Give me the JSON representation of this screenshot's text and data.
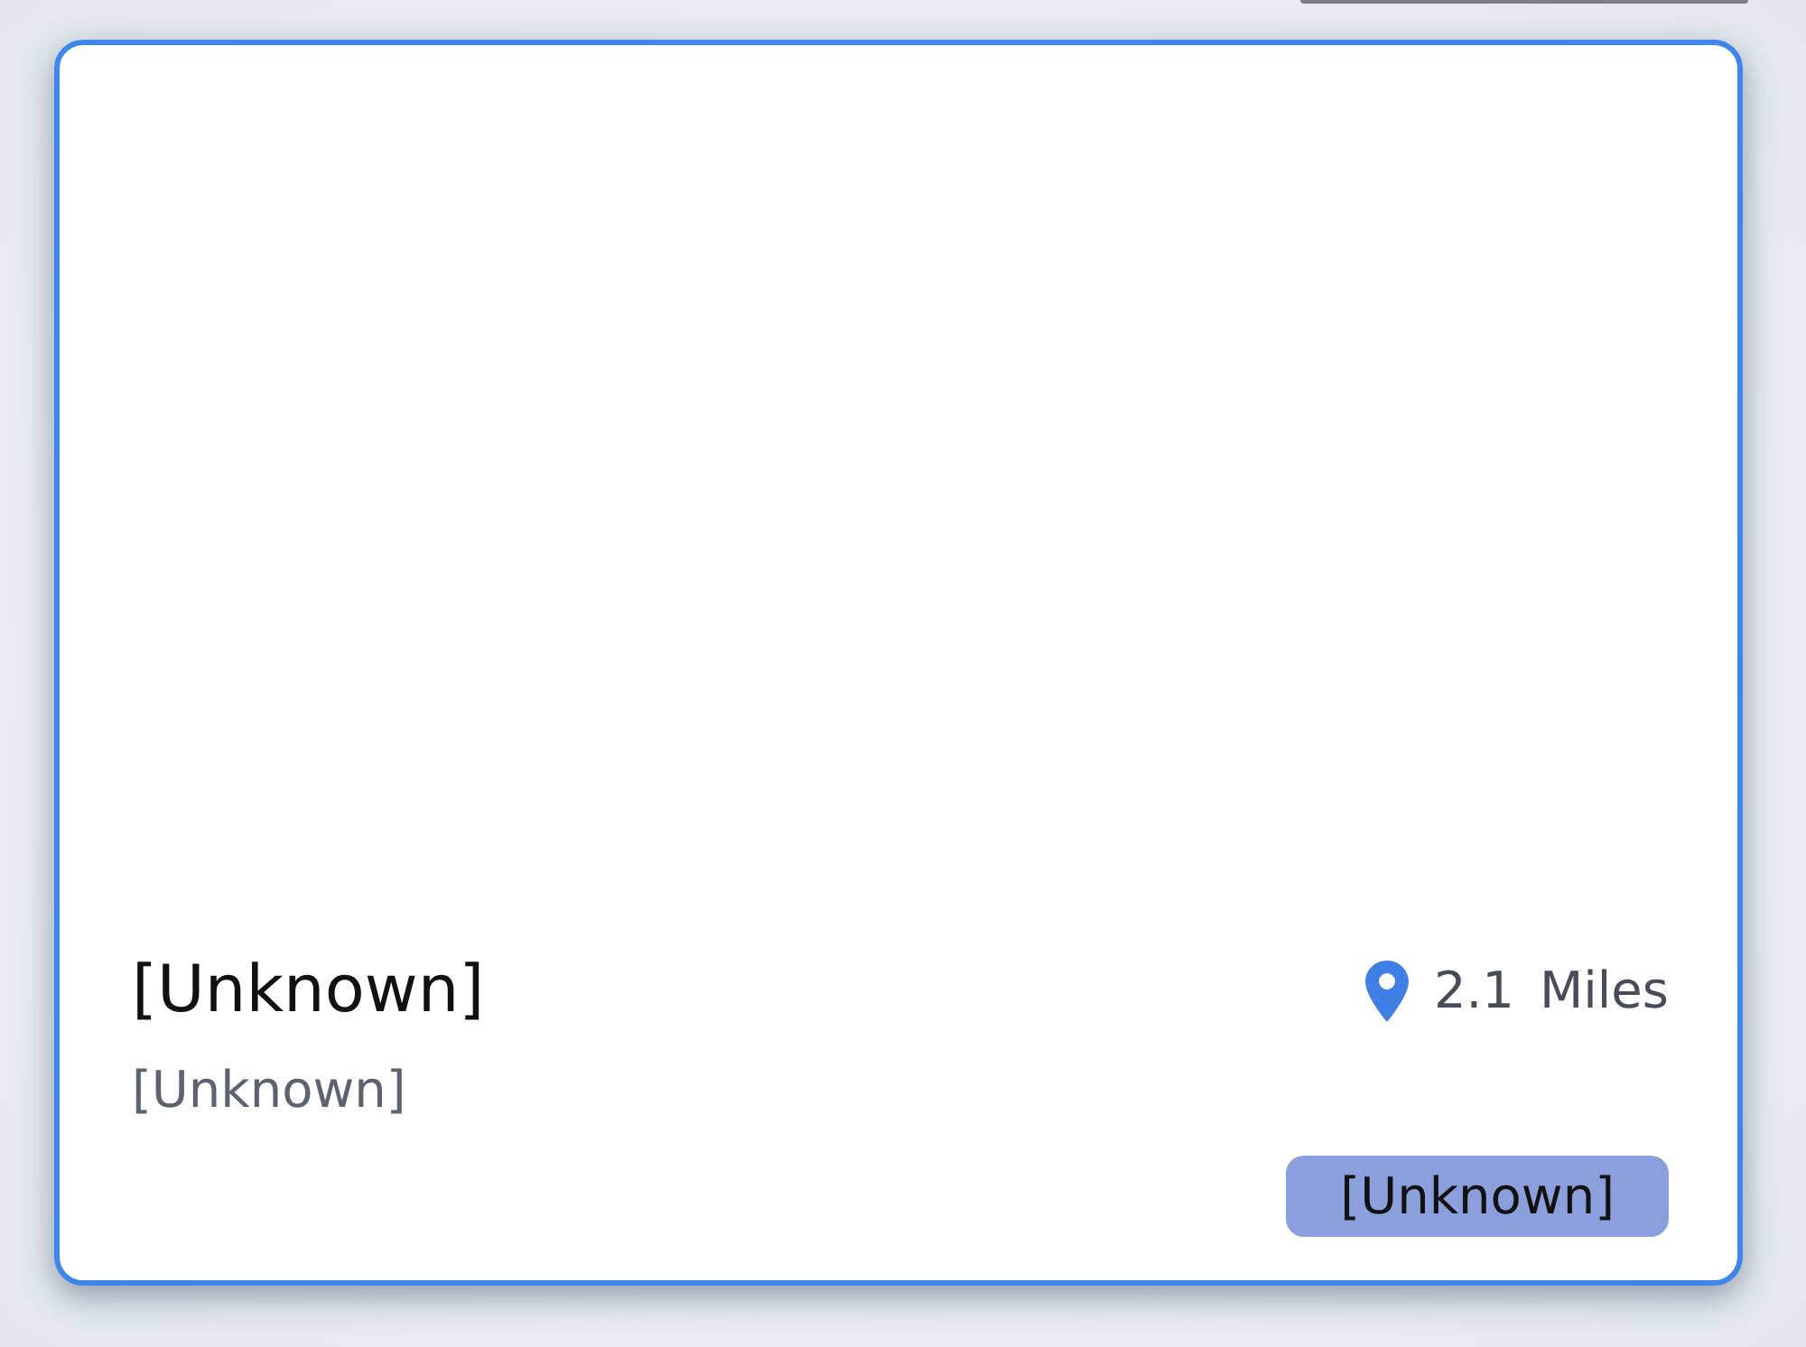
{
  "card": {
    "selected": true,
    "title": "[Unknown]",
    "subtitle": "[Unknown]",
    "distance": {
      "value": "2.1",
      "unit": "Miles"
    },
    "tag": "[Unknown]"
  }
}
